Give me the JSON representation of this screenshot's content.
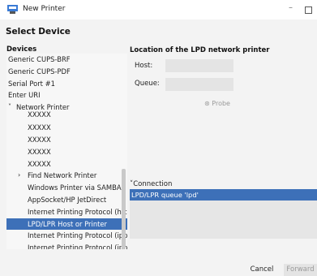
{
  "window": {
    "title": "New Printer"
  },
  "page": {
    "heading": "Select Device"
  },
  "devices": {
    "header": "Devices",
    "items": [
      "Generic CUPS-BRF",
      "Generic CUPS-PDF",
      "Serial Port #1",
      "Enter URI"
    ],
    "network": {
      "label": "Network Printer",
      "children": [
        "XXXXX",
        "XXXXX",
        "XXXXX",
        "XXXXX",
        "XXXXX"
      ],
      "find_label": "Find Network Printer",
      "sub_items": [
        "Windows Printer via SAMBA",
        "AppSocket/HP JetDirect",
        "Internet Printing Protocol (https)",
        "LPD/LPR Host or Printer",
        "Internet Printing Protocol (ipps)",
        "Internet Printing Protocol (ipp)"
      ],
      "selected": "LPD/LPR Host or Printer"
    }
  },
  "details": {
    "heading": "Location of the LPD network printer",
    "host_label": "Host:",
    "host_value": "",
    "queue_label": "Queue:",
    "queue_value": "",
    "probe_label": "Probe"
  },
  "connection": {
    "label": "Connection",
    "items": [
      "LPD/LPR queue 'lpd'"
    ]
  },
  "buttons": {
    "cancel": "Cancel",
    "forward": "Forward"
  },
  "colors": {
    "selection": "#3d70b8",
    "window_bg": "#f3f3f3"
  }
}
